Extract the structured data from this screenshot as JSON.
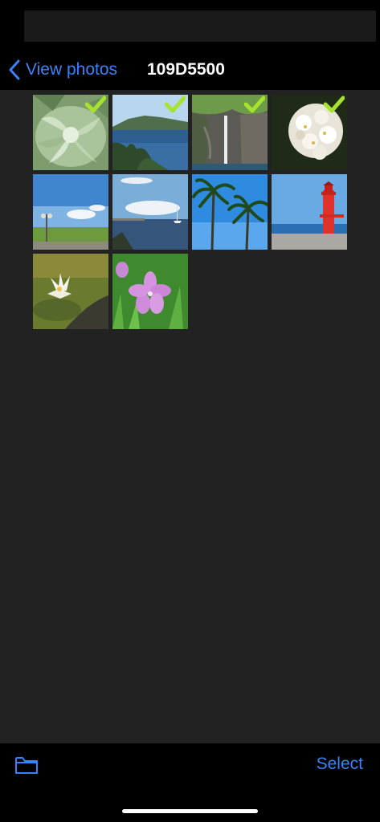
{
  "nav": {
    "back_label": "View photos",
    "title": "109D5500"
  },
  "toolbar": {
    "folder_icon": "folder-icon",
    "select_label": "Select"
  },
  "colors": {
    "accent": "#3a82f7",
    "check": "#a6e22e",
    "grid_background": "#222222",
    "bar_background": "#000000"
  },
  "photos": [
    {
      "subject": "succulent",
      "selected": true
    },
    {
      "subject": "sea-bay",
      "selected": true
    },
    {
      "subject": "waterfall-cliff",
      "selected": true
    },
    {
      "subject": "white-flowers",
      "selected": true
    },
    {
      "subject": "streetlamp-field",
      "selected": false
    },
    {
      "subject": "harbor-sailboat",
      "selected": false
    },
    {
      "subject": "palm-trees",
      "selected": false
    },
    {
      "subject": "red-lighthouse",
      "selected": false
    },
    {
      "subject": "water-lily",
      "selected": false
    },
    {
      "subject": "pink-flower",
      "selected": false
    }
  ]
}
